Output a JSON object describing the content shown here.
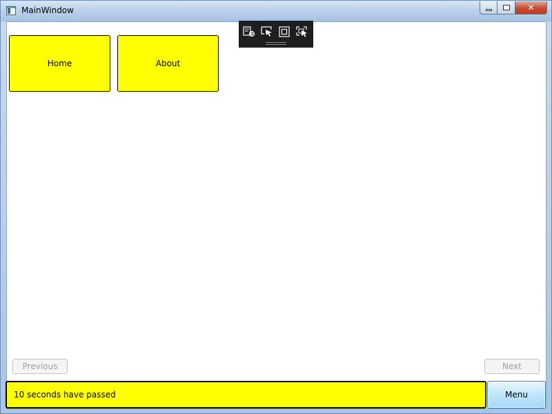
{
  "window": {
    "title": "MainWindow",
    "close_glyph": "✕"
  },
  "debug_toolbar": {
    "icons": [
      "select-element-icon",
      "track-focus-icon",
      "display-layout-adorners-icon",
      "preview-selection-icon"
    ]
  },
  "nav": {
    "tiles": [
      {
        "label": "Home"
      },
      {
        "label": "About"
      }
    ]
  },
  "pager": {
    "previous_label": "Previous",
    "next_label": "Next"
  },
  "status": {
    "message": "10 seconds have passed"
  },
  "menu": {
    "label": "Menu"
  },
  "colors": {
    "tile_bg": "#ffff00",
    "status_bg": "#ffff00",
    "menu_button_bg": "#bee6fd",
    "toolbar_bg": "#1e1e1e"
  }
}
